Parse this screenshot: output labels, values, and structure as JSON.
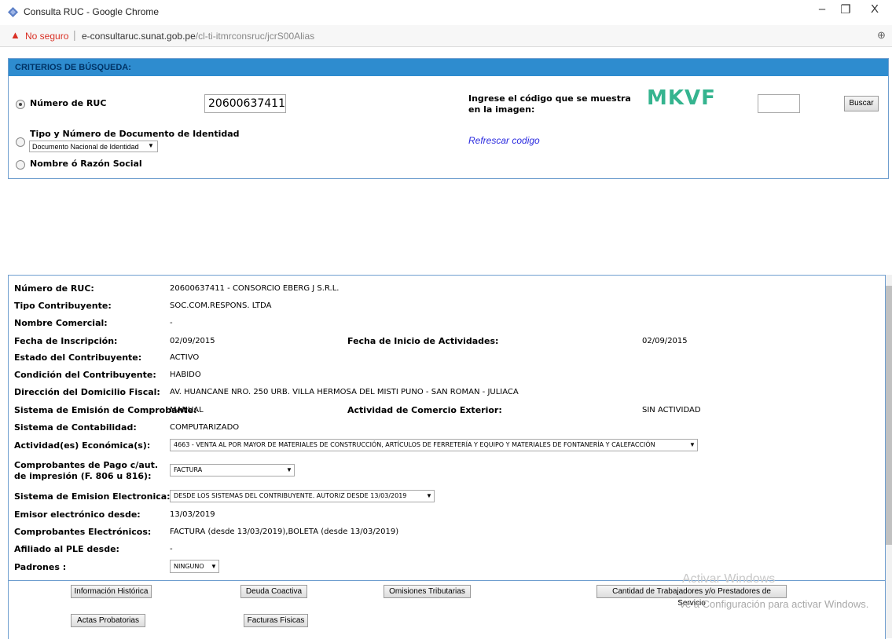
{
  "browser": {
    "title": "Consulta RUC - Google Chrome",
    "not_secure": "No seguro",
    "url_host": "e-consultaruc.sunat.gob.pe",
    "url_path": "/cl-ti-itmrconsruc/jcrS00Alias",
    "controls": [
      "–",
      "❐",
      "X"
    ]
  },
  "search": {
    "header": "CRITERIOS DE BÚSQUEDA:",
    "ruc_label": "Número de RUC",
    "ruc_value": "20600637411",
    "doc_label": "Tipo y Número de Documento de Identidad",
    "doc_option": "Documento Nacional de Identidad",
    "name_label": "Nombre ó Razón Social",
    "captcha_prompt": "Ingrese el código que se muestra en la imagen:",
    "captcha_text": "MKVF",
    "captcha_input": "",
    "refresh_link": "Refrescar codigo",
    "search_button": "Buscar"
  },
  "result": {
    "rows": [
      {
        "label": "Número de RUC:",
        "value": "20600637411 - CONSORCIO EBERG J S.R.L."
      },
      {
        "label": "Tipo Contribuyente:",
        "value": "SOC.COM.RESPONS. LTDA"
      },
      {
        "label": "Nombre Comercial:",
        "value": "-"
      },
      {
        "label": "Fecha de Inscripción:",
        "value": "02/09/2015",
        "label2": "Fecha de Inicio de Actividades:",
        "value2": "02/09/2015"
      },
      {
        "label": "Estado del Contribuyente:",
        "value": "ACTIVO"
      },
      {
        "label": "Condición del Contribuyente:",
        "value": "HABIDO"
      },
      {
        "label": "Dirección del Domicilio Fiscal:",
        "value": "AV. HUANCANE NRO. 250 URB. VILLA HERMOSA DEL MISTI PUNO - SAN ROMAN - JULIACA"
      },
      {
        "label": "Sistema de Emisión de Comprobante:",
        "value": "MANUAL",
        "label2": "Actividad de Comercio Exterior:",
        "value2": "SIN ACTIVIDAD"
      },
      {
        "label": "Sistema de Contabilidad:",
        "value": "COMPUTARIZADO"
      },
      {
        "label": "Actividad(es) Económica(s):",
        "value": "4663 - VENTA AL POR MAYOR DE MATERIALES DE CONSTRUCCIÓN, ARTÍCULOS DE FERRETERÍA Y EQUIPO Y MATERIALES DE FONTANERÍA Y CALEFACCIÓN"
      },
      {
        "label": "Comprobantes de Pago c/aut. de impresión (F. 806 u 816):",
        "value": "FACTURA"
      },
      {
        "label": "Sistema de Emision Electronica:",
        "value": "DESDE LOS SISTEMAS DEL CONTRIBUYENTE. AUTORIZ DESDE 13/03/2019"
      },
      {
        "label": "Emisor electrónico desde:",
        "value": "13/03/2019"
      },
      {
        "label": "Comprobantes Electrónicos:",
        "value": "FACTURA (desde 13/03/2019),BOLETA (desde 13/03/2019)"
      },
      {
        "label": "Afiliado al PLE desde:",
        "value": "-"
      },
      {
        "label": "Padrones :",
        "value": "NINGUNO"
      }
    ],
    "buttons": [
      "Información Histórica",
      "Deuda Coactiva",
      "Omisiones Tributarias",
      "Cantidad de Trabajadores y/o Prestadores de Servicio",
      "Actas Probatorias",
      "Facturas Fisicas"
    ]
  },
  "watermark": {
    "line1": "Activar Windows",
    "line2": "Ve a Configuración para activar Windows."
  }
}
